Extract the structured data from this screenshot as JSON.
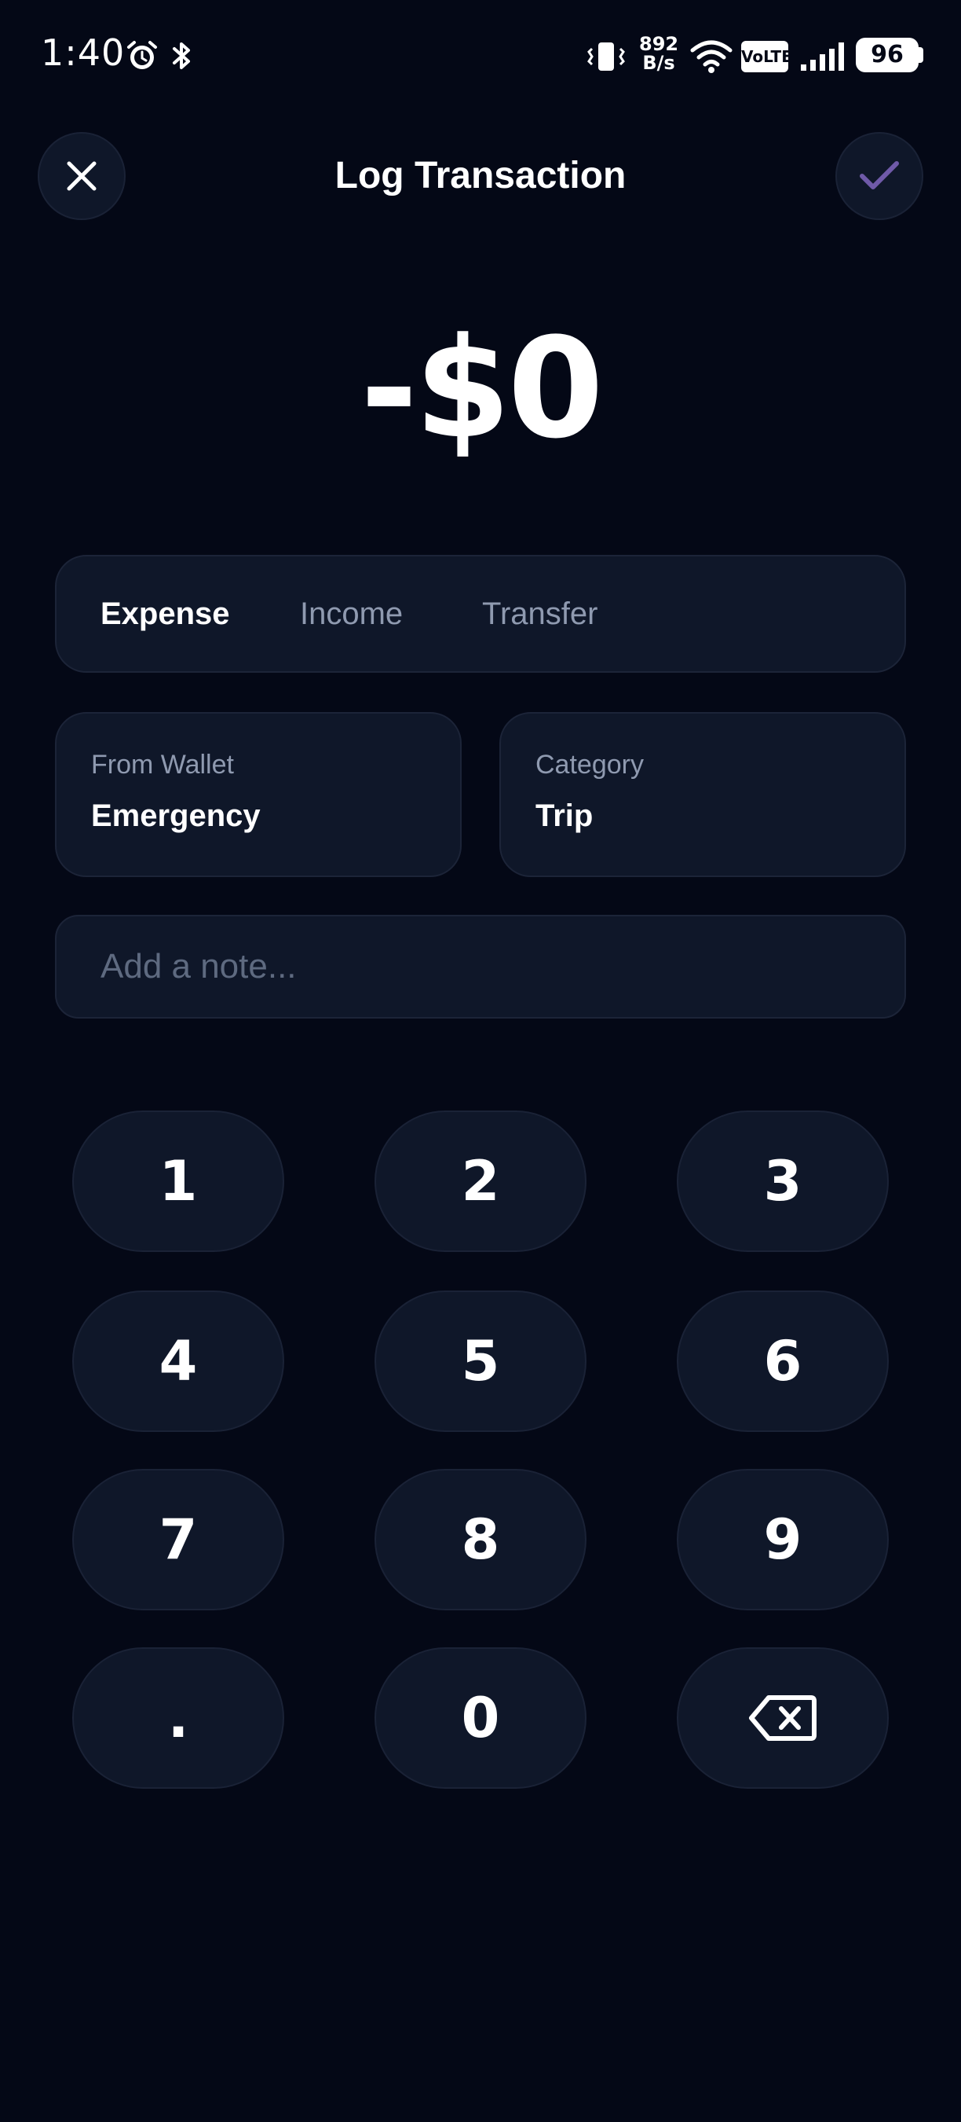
{
  "status_bar": {
    "time": "1:40",
    "net_speed_value": "892",
    "net_speed_unit": "B/s",
    "volte": "VoLTE",
    "battery": "96",
    "icons": [
      "alarm-icon",
      "bluetooth-icon",
      "vibrate-icon",
      "wifi-icon",
      "signal-icon",
      "battery-icon"
    ]
  },
  "header": {
    "title": "Log Transaction",
    "close_icon": "close-icon",
    "confirm_icon": "check-icon"
  },
  "amount": {
    "display": "-$0"
  },
  "type_tabs": {
    "items": [
      {
        "label": "Expense",
        "selected": true
      },
      {
        "label": "Income",
        "selected": false
      },
      {
        "label": "Transfer",
        "selected": false
      }
    ]
  },
  "wallet": {
    "label": "From Wallet",
    "value": "Emergency"
  },
  "category": {
    "label": "Category",
    "value": "Trip"
  },
  "note": {
    "placeholder": "Add a note...",
    "value": ""
  },
  "keypad": {
    "keys": [
      "1",
      "2",
      "3",
      "4",
      "5",
      "6",
      "7",
      "8",
      "9",
      ".",
      "0"
    ],
    "backspace_icon": "backspace-icon"
  },
  "colors": {
    "background": "#040816",
    "surface": "#0f1729",
    "muted_text": "#8f9ab0",
    "confirm_check": "#6f5aa8"
  }
}
